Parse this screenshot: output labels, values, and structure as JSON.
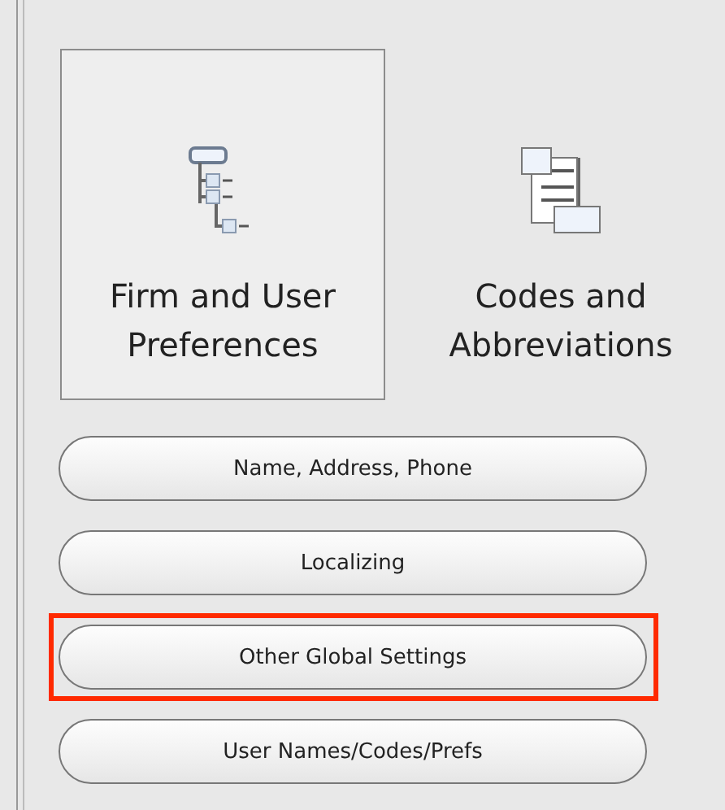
{
  "tiles": [
    {
      "kind": "tree",
      "label": "Firm and User Preferences",
      "selected": true
    },
    {
      "kind": "codes",
      "label": "Codes and Abbreviations",
      "selected": false
    }
  ],
  "buttons": [
    {
      "label": "Name, Address, Phone",
      "highlighted": false
    },
    {
      "label": "Localizing",
      "highlighted": false
    },
    {
      "label": "Other Global Settings",
      "highlighted": true
    },
    {
      "label": "User Names/Codes/Prefs",
      "highlighted": false
    }
  ]
}
